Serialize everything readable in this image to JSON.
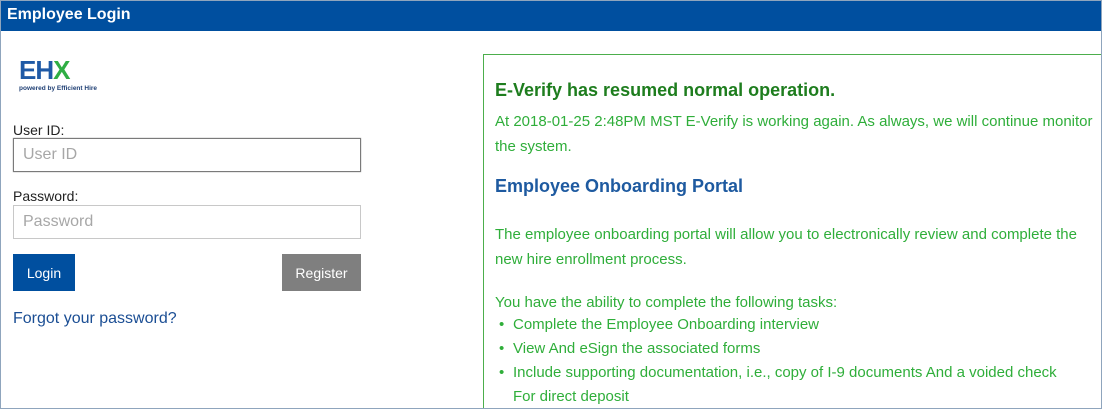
{
  "window": {
    "title": "Employee Login"
  },
  "logo": {
    "main": "EHX",
    "tagline": "powered by Efficient Hire"
  },
  "form": {
    "userid_label": "User ID:",
    "userid_placeholder": "User ID",
    "password_label": "Password:",
    "password_placeholder": "Password",
    "login_label": "Login",
    "register_label": "Register",
    "forgot_label": "Forgot your password?"
  },
  "notice": {
    "title": "E-Verify has resumed normal operation.",
    "status_text": "At 2018-01-25 2:48PM MST E-Verify is working again. As always, we will continue monitor the system.",
    "portal_heading": "Employee Onboarding Portal",
    "portal_text": "The employee onboarding portal will allow you to electronically review and complete the new hire enrollment process.",
    "tasks_intro": "You have the ability to complete the following tasks:",
    "tasks": [
      "Complete the Employee Onboarding interview",
      "View And eSign the associated forms",
      "Include supporting documentation, i.e., copy of I-9 documents And a voided check For direct deposit"
    ]
  },
  "colors": {
    "titlebar": "#004f9f",
    "login_button": "#004f9f",
    "register_button": "#7f7f7f",
    "notice_border": "#4cae4c",
    "notice_text": "#2fae3a",
    "link": "#1b4e94"
  }
}
